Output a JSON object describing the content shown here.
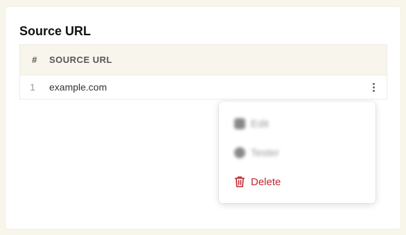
{
  "card": {
    "title": "Source URL"
  },
  "table": {
    "headers": {
      "num": "#",
      "url": "SOURCE URL"
    },
    "rows": [
      {
        "num": "1",
        "url": "example.com"
      }
    ]
  },
  "menu": {
    "items": [
      {
        "label": "Edit",
        "icon": "edit-icon"
      },
      {
        "label": "Tester",
        "icon": "tester-icon"
      },
      {
        "label": "Delete",
        "icon": "trash-icon",
        "color": "#c0262d"
      }
    ]
  }
}
